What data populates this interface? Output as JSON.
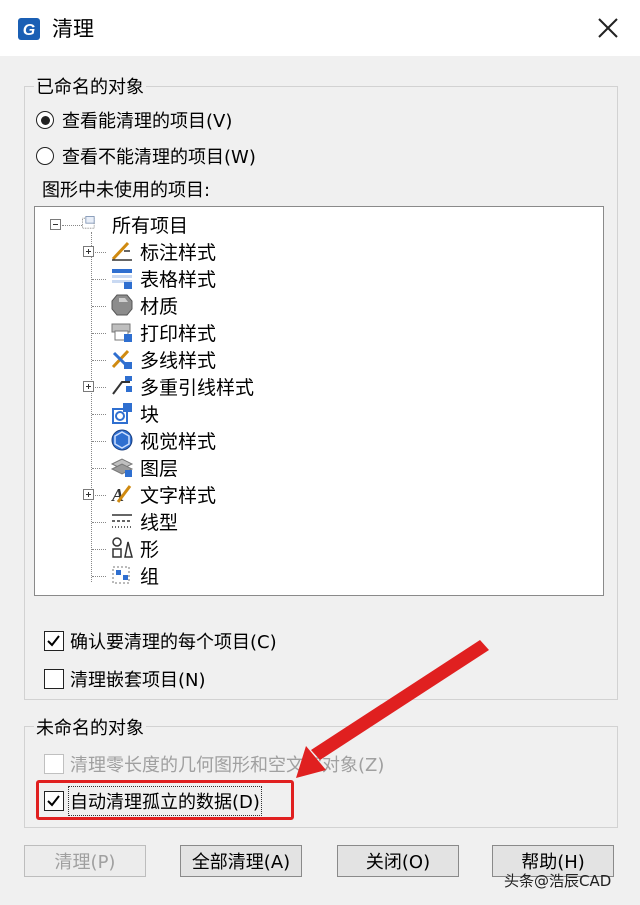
{
  "window": {
    "title": "清理",
    "app_icon": "gstarcad-logo-icon",
    "close_icon": "close-icon"
  },
  "named_objects": {
    "group_label": "已命名的对象",
    "radio_can_purge": "查看能清理的项目(V)",
    "radio_cannot_purge": "查看不能清理的项目(W)",
    "selected": "can_purge",
    "tree_label": "图形中未使用的项目:",
    "tree": {
      "root": "所有项目",
      "items": [
        {
          "label": "标注样式",
          "icon": "dimension-style-icon",
          "expandable": true
        },
        {
          "label": "表格样式",
          "icon": "table-style-icon",
          "expandable": false
        },
        {
          "label": "材质",
          "icon": "material-icon",
          "expandable": false
        },
        {
          "label": "打印样式",
          "icon": "plot-style-icon",
          "expandable": false
        },
        {
          "label": "多线样式",
          "icon": "multiline-style-icon",
          "expandable": false
        },
        {
          "label": "多重引线样式",
          "icon": "multileader-style-icon",
          "expandable": true
        },
        {
          "label": "块",
          "icon": "block-icon",
          "expandable": false
        },
        {
          "label": "视觉样式",
          "icon": "visual-style-icon",
          "expandable": false
        },
        {
          "label": "图层",
          "icon": "layer-icon",
          "expandable": false
        },
        {
          "label": "文字样式",
          "icon": "text-style-icon",
          "expandable": true
        },
        {
          "label": "线型",
          "icon": "linetype-icon",
          "expandable": false
        },
        {
          "label": "形",
          "icon": "shape-icon",
          "expandable": false
        },
        {
          "label": "组",
          "icon": "group-icon",
          "expandable": false
        }
      ]
    },
    "confirm_each": {
      "label": "确认要清理的每个项目(C)",
      "checked": true
    },
    "purge_nested": {
      "label": "清理嵌套项目(N)",
      "checked": false
    }
  },
  "unnamed_objects": {
    "group_label": "未命名的对象",
    "zero_length": {
      "label": "清理零长度的几何图形和空文字对象(Z)",
      "checked": false,
      "enabled": false
    },
    "orphaned_data": {
      "label": "自动清理孤立的数据(D)",
      "checked": true,
      "enabled": true
    }
  },
  "buttons": {
    "purge": "清理(P)",
    "purge_all": "全部清理(A)",
    "close": "关闭(O)",
    "help": "帮助(H)"
  },
  "watermark": {
    "text": "头条@浩辰CAD"
  },
  "colors": {
    "highlight": "#e02020",
    "dialog_bg": "#f0f0f0"
  }
}
